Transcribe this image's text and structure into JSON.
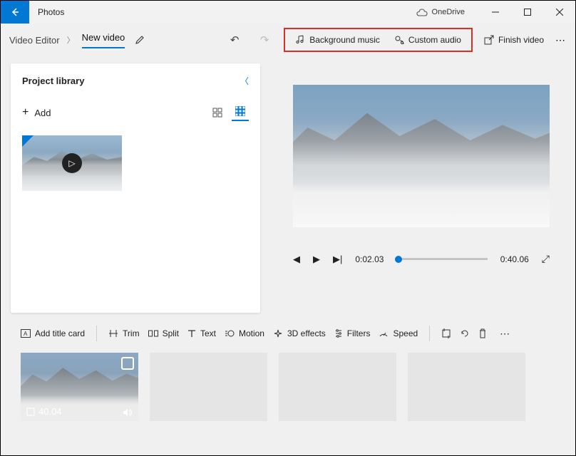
{
  "titlebar": {
    "app_name": "Photos",
    "onedrive": "OneDrive"
  },
  "breadcrumb": {
    "root": "Video Editor",
    "current": "New video"
  },
  "actions": {
    "bg_music": "Background music",
    "custom_audio": "Custom audio",
    "finish": "Finish video"
  },
  "project": {
    "title": "Project library",
    "add": "Add"
  },
  "playback": {
    "elapsed": "0:02.03",
    "total": "0:40.06"
  },
  "tools": {
    "title_card": "Add title card",
    "trim": "Trim",
    "split": "Split",
    "text": "Text",
    "motion": "Motion",
    "fx3d": "3D effects",
    "filters": "Filters",
    "speed": "Speed"
  },
  "clip": {
    "duration": "40.04"
  }
}
